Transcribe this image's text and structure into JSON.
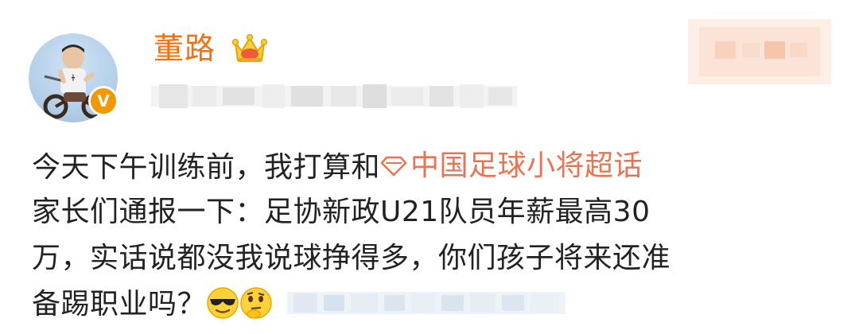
{
  "post": {
    "author": {
      "name": "董路",
      "avatar_icon": "avatar-photo",
      "verified_badge": "V",
      "member_icon": "crown-icon"
    },
    "topic": {
      "label": "中国足球小将超话",
      "icon": "diamond-icon"
    },
    "text": {
      "line1_prefix": "今天下午训练前，我打算和",
      "line2": "家长们通报一下：足协新政U21队员年薪最高30",
      "line3": "万，实话说都没我说球挣得多，你们孩子将来还准",
      "line4_prefix": "备踢职业吗？"
    },
    "emojis": [
      "cool-face-emoji",
      "thinking-face-emoji"
    ],
    "colors": {
      "username": "#f86f0a",
      "topic": "#eb7350",
      "text": "#222222",
      "badge": "#f39800"
    }
  }
}
